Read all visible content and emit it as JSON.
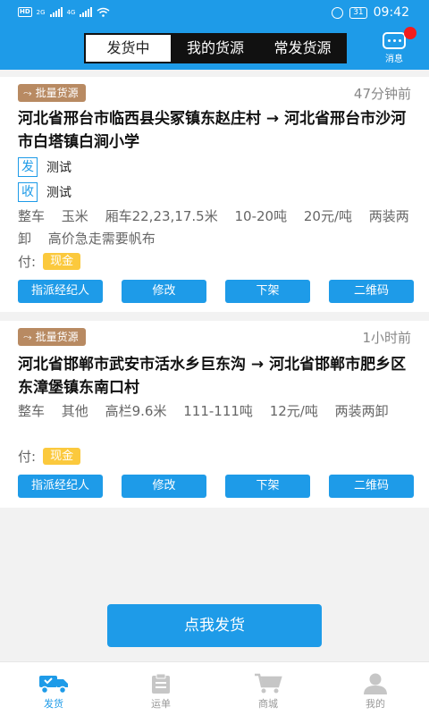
{
  "status_bar": {
    "hd": "HD",
    "net1": "2G",
    "net2": "4G",
    "battery": "31",
    "time": "09:42"
  },
  "tabs": [
    {
      "label": "发货中",
      "active": true
    },
    {
      "label": "我的货源",
      "active": false
    },
    {
      "label": "常发货源",
      "active": false
    }
  ],
  "message": {
    "label": "消息"
  },
  "cargo": [
    {
      "badge": "批量货源",
      "time": "47分钟前",
      "route": "河北省邢台市临西县尖冢镇东赵庄村 → 河北省邢台市沙河市白塔镇白涧小学",
      "sender_tag": "发",
      "sender": "测试",
      "receiver_tag": "收",
      "receiver": "测试",
      "specs": [
        "整车",
        "玉米",
        "厢车22,23,17.5米",
        "10-20吨",
        "20元/吨",
        "两装两卸",
        "高价急走需要帆布"
      ],
      "pay_label": "付:",
      "pay_method": "现金",
      "actions": [
        "指派经纪人",
        "修改",
        "下架",
        "二维码"
      ]
    },
    {
      "badge": "批量货源",
      "time": "1小时前",
      "route": "河北省邯郸市武安市活水乡巨东沟 → 河北省邯郸市肥乡区东漳堡镇东南口村",
      "specs": [
        "整车",
        "其他",
        "高栏9.6米",
        "111-111吨",
        "12元/吨",
        "两装两卸"
      ],
      "pay_label": "付:",
      "pay_method": "现金",
      "actions": [
        "指派经纪人",
        "修改",
        "下架",
        "二维码"
      ]
    }
  ],
  "publish_button": "点我发货",
  "bottom_nav": [
    {
      "label": "发货",
      "icon": "truck-icon",
      "active": true
    },
    {
      "label": "运单",
      "icon": "clipboard-icon",
      "active": false
    },
    {
      "label": "商城",
      "icon": "cart-icon",
      "active": false
    },
    {
      "label": "我的",
      "icon": "person-icon",
      "active": false
    }
  ],
  "colors": {
    "primary": "#1e9be8",
    "badge": "#b88a62",
    "cash": "#fbc93d",
    "notify": "#f31c1c"
  }
}
